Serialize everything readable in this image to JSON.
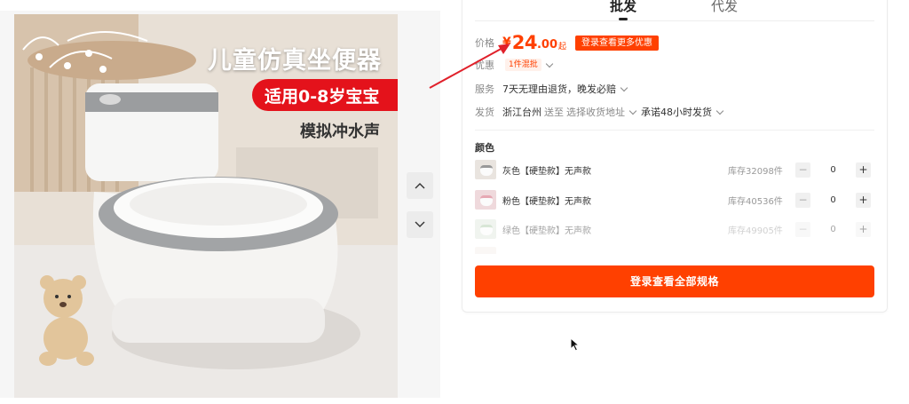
{
  "gallery": {
    "headline": "儿童仿真坐便器",
    "badge": "适用0-8岁宝宝",
    "feature": "模拟冲水声"
  },
  "tabs": [
    {
      "label": "批发",
      "active": true
    },
    {
      "label": "代发",
      "active": false
    }
  ],
  "price": {
    "label": "价格",
    "currency": "¥",
    "integer": "24",
    "decimal": ".00",
    "suffix": "起",
    "promo_button": "登录查看更多优惠"
  },
  "discount": {
    "label": "优惠",
    "tag": "1件混批"
  },
  "service": {
    "label": "服务",
    "text": "7天无理由退货，晚发必赔"
  },
  "shipping": {
    "label": "发货",
    "origin": "浙江台州",
    "to": "送至",
    "address_select": "选择收货地址",
    "promise": "承诺48小时发货"
  },
  "sku_section": {
    "title": "颜色",
    "items": [
      {
        "name": "灰色【硬垫款】无声款",
        "stock": "库存32098件",
        "qty": "0"
      },
      {
        "name": "粉色【硬垫款】无声款",
        "stock": "库存40536件",
        "qty": "0"
      },
      {
        "name": "绿色【硬垫款】无声款",
        "stock": "库存49905件",
        "qty": "0"
      }
    ]
  },
  "cta_label": "登录查看全部规格",
  "colors": {
    "accent": "#ff4000",
    "annotation_arrow": "#e0202a"
  },
  "icons": [
    "chevron-up-icon",
    "chevron-down-icon",
    "dropdown-chevron-icon",
    "minus-icon",
    "plus-icon",
    "cursor-icon"
  ]
}
